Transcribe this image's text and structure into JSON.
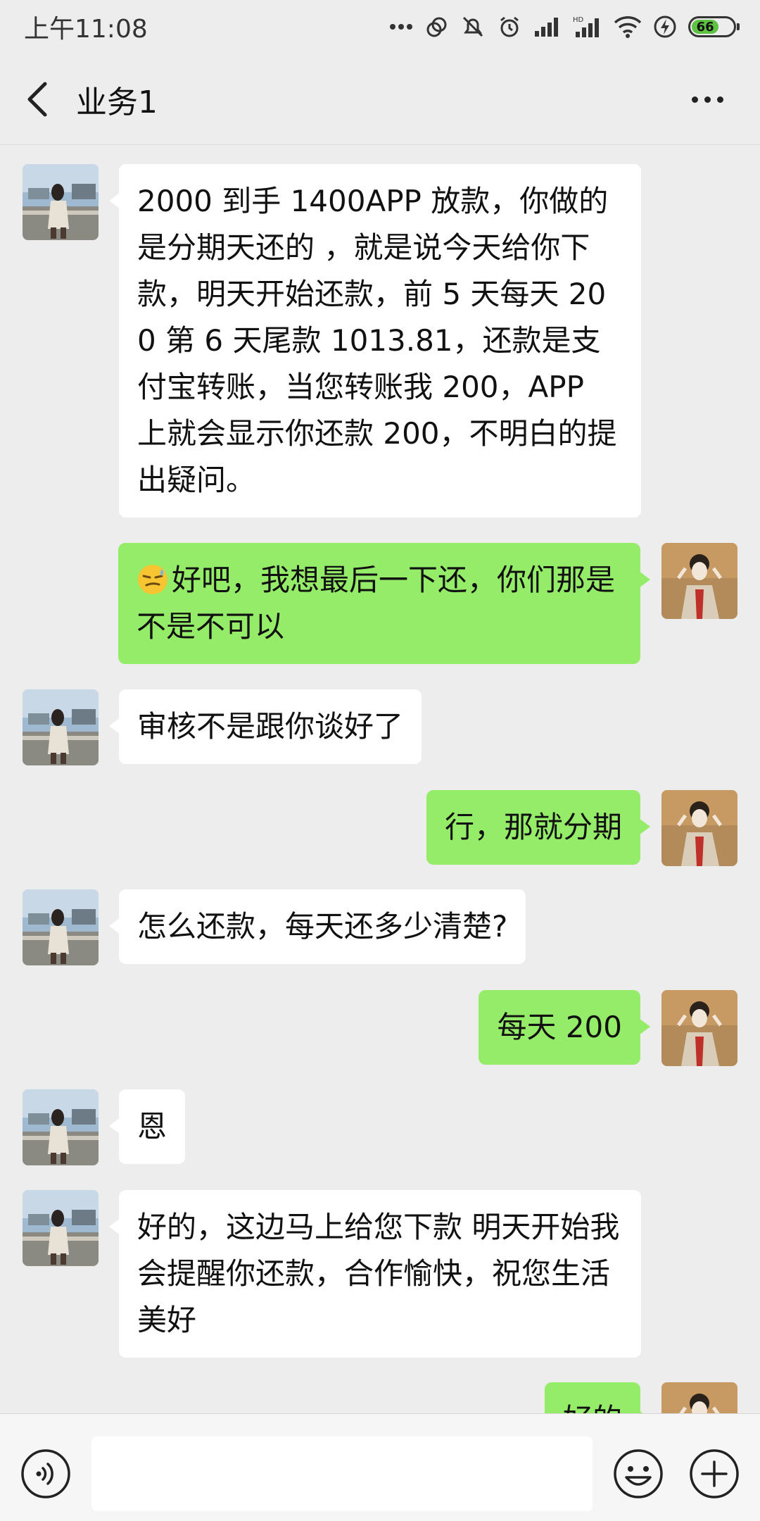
{
  "status_bar": {
    "time": "上午11:08",
    "battery_level": "66",
    "battery_fraction": 0.66,
    "battery_color": "#5ec243"
  },
  "header": {
    "title": "业务1",
    "back_icon": "back-arrow-icon",
    "more_icon": "more-dots-icon"
  },
  "colors": {
    "background": "#ededed",
    "incoming_bubble": "#ffffff",
    "outgoing_bubble": "#95ec69"
  },
  "messages": [
    {
      "sender": "other",
      "text": "2000 到手 1400APP 放款，你做的是分期天还的 ，就是说今天给你下款，明天开始还款，前 5 天每天 200 第 6 天尾款 1013.81，还款是支付宝转账，当您转账我 200，APP 上就会显示你还款 200，不明白的提出疑问。"
    },
    {
      "sender": "self",
      "emoji": "smirk-sweat-emoji",
      "text": "好吧，我想最后一下还，你们那是不是不可以"
    },
    {
      "sender": "other",
      "text": "审核不是跟你谈好了"
    },
    {
      "sender": "self",
      "text": "行，那就分期"
    },
    {
      "sender": "other",
      "text": "怎么还款，每天还多少清楚?"
    },
    {
      "sender": "self",
      "text": "每天 200"
    },
    {
      "sender": "other",
      "text": "恩"
    },
    {
      "sender": "other",
      "text": "好的，这边马上给您下款  明天开始我会提醒你还款，合作愉快，祝您生活美好"
    },
    {
      "sender": "self",
      "text": "好的"
    }
  ],
  "input_bar": {
    "voice_icon": "voice-icon",
    "emoji_icon": "emoji-icon",
    "plus_icon": "plus-icon",
    "value": ""
  }
}
